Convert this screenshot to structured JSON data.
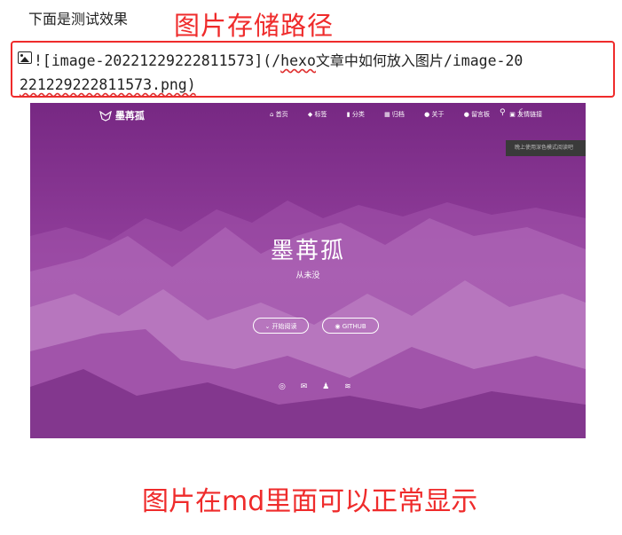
{
  "intro_text": "下面是测试效果",
  "annotation_top": "图片存储路径",
  "markdown": {
    "line1_prefix": "![",
    "alt_text": "image-20221229222811573",
    "line1_mid": "](/",
    "path_hexo": "hexo",
    "path_cjk": "文章中如何放入图片",
    "line1_tail": "/image-20",
    "line2": "221229222811573.png)"
  },
  "preview": {
    "site_title": "墨苒孤",
    "nav_items": [
      "首页",
      "标签",
      "分类",
      "归档",
      "关于",
      "留言板",
      "友情链接"
    ],
    "tooltip": "晚上使用深色模式阅读吧",
    "hero_title": "墨苒孤",
    "hero_subtitle": "从未没",
    "btn_read": "开始阅读",
    "btn_github": "GITHUB",
    "social_icons": [
      "github-icon",
      "mail-icon",
      "qq-icon",
      "rss-icon"
    ],
    "colors": {
      "overlay": "#8e3b98"
    }
  },
  "annotation_bottom": "图片在md里面可以正常显示",
  "colors": {
    "annotation": "#ef2b2b"
  }
}
